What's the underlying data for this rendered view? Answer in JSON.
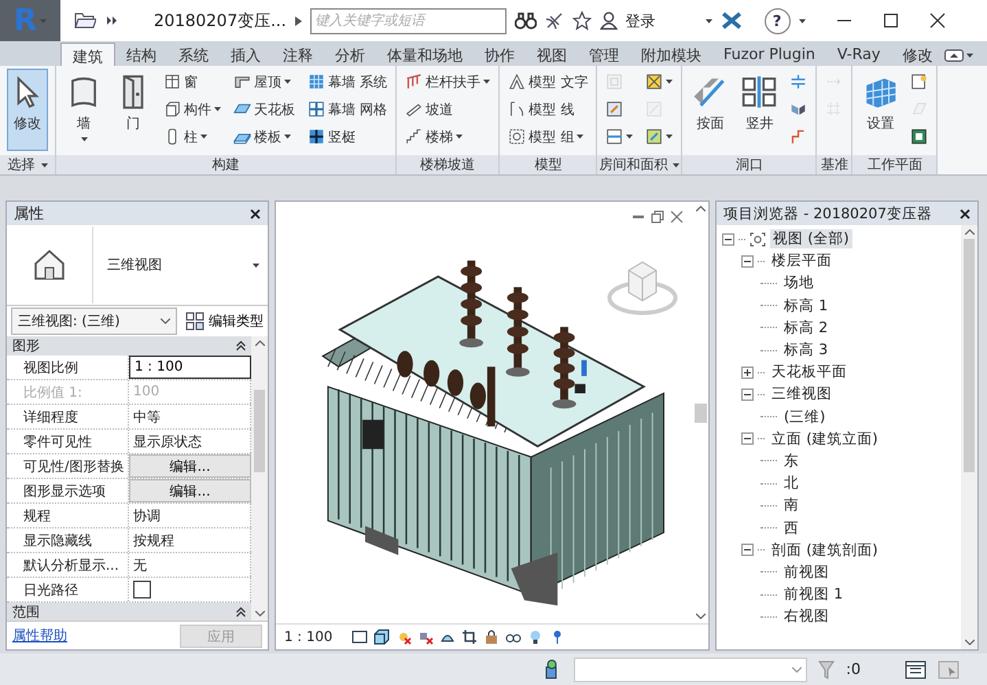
{
  "title_bar": {
    "app_button": "R",
    "title": "20180207变压...",
    "search": {
      "placeholder": "键入关键字或短语"
    },
    "sign_in": "登录",
    "help": "?"
  },
  "tabs": [
    {
      "label": "建筑",
      "selected": true
    },
    {
      "label": "结构",
      "selected": false
    },
    {
      "label": "系统",
      "selected": false
    },
    {
      "label": "插入",
      "selected": false
    },
    {
      "label": "注释",
      "selected": false
    },
    {
      "label": "分析",
      "selected": false
    },
    {
      "label": "体量和场地",
      "selected": false
    },
    {
      "label": "协作",
      "selected": false
    },
    {
      "label": "视图",
      "selected": false
    },
    {
      "label": "管理",
      "selected": false
    },
    {
      "label": "附加模块",
      "selected": false
    },
    {
      "label": "Fuzor Plugin",
      "selected": false
    },
    {
      "label": "V-Ray",
      "selected": false
    },
    {
      "label": "修改",
      "selected": false
    }
  ],
  "ribbon": {
    "panels": [
      {
        "title": "选择",
        "menu": true,
        "tools": [
          {
            "label": "修改",
            "kind": "large",
            "dropdown": false,
            "active": true
          }
        ]
      },
      {
        "title": "构建",
        "menu": false,
        "tools": [
          {
            "label": "墙",
            "kind": "large",
            "dropdown": true
          },
          {
            "label": "门",
            "kind": "large",
            "dropdown": false
          },
          {
            "label": "窗",
            "kind": "small",
            "dropdown": false
          },
          {
            "label": "构件",
            "kind": "small",
            "dropdown": true
          },
          {
            "label": "柱",
            "kind": "small",
            "dropdown": true
          },
          {
            "label": "屋顶",
            "kind": "small",
            "dropdown": true
          },
          {
            "label": "天花板",
            "kind": "small",
            "dropdown": false
          },
          {
            "label": "楼板",
            "kind": "small",
            "dropdown": true
          },
          {
            "label": "幕墙 系统",
            "kind": "small",
            "dropdown": false
          },
          {
            "label": "幕墙 网格",
            "kind": "small",
            "dropdown": false
          },
          {
            "label": "竖梃",
            "kind": "small",
            "dropdown": false
          }
        ]
      },
      {
        "title": "楼梯坡道",
        "menu": false,
        "tools": [
          {
            "label": "栏杆扶手",
            "kind": "small",
            "dropdown": true
          },
          {
            "label": "坡道",
            "kind": "small",
            "dropdown": false
          },
          {
            "label": "楼梯",
            "kind": "small",
            "dropdown": true
          }
        ]
      },
      {
        "title": "模型",
        "menu": false,
        "tools": [
          {
            "label": "模型 文字",
            "kind": "small",
            "dropdown": false
          },
          {
            "label": "模型 线",
            "kind": "small",
            "dropdown": false
          },
          {
            "label": "模型 组",
            "kind": "small",
            "dropdown": true
          }
        ]
      },
      {
        "title": "房间和面积",
        "menu": true,
        "tools": [
          {
            "kind": "small",
            "dropdown": false,
            "disabled": true
          },
          {
            "kind": "small",
            "dropdown": false,
            "disabled": false
          },
          {
            "kind": "small",
            "dropdown": true,
            "disabled": false
          },
          {
            "kind": "small",
            "dropdown": true,
            "disabled": false
          },
          {
            "kind": "small",
            "dropdown": false,
            "disabled": true
          },
          {
            "kind": "small",
            "dropdown": true,
            "disabled": false
          }
        ]
      },
      {
        "title": "洞口",
        "menu": false,
        "tools": [
          {
            "label": "按面",
            "kind": "large",
            "dropdown": false
          },
          {
            "label": "竖井",
            "kind": "large",
            "dropdown": false
          },
          {
            "kind": "small",
            "dropdown": false
          },
          {
            "kind": "small",
            "dropdown": false
          },
          {
            "kind": "small",
            "dropdown": false
          }
        ]
      },
      {
        "title": "基准",
        "menu": false,
        "tools": [
          {
            "kind": "small",
            "dropdown": false,
            "disabled": true
          },
          {
            "kind": "small",
            "dropdown": false,
            "disabled": true
          }
        ]
      },
      {
        "title": "工作平面",
        "menu": false,
        "tools": [
          {
            "label": "设置",
            "kind": "large",
            "dropdown": false,
            "disabled": false
          },
          {
            "kind": "small",
            "dropdown": false,
            "disabled": false
          },
          {
            "kind": "small",
            "dropdown": false,
            "disabled": true
          },
          {
            "kind": "small",
            "dropdown": false,
            "disabled": false
          }
        ]
      }
    ]
  },
  "properties": {
    "title": "属性",
    "type_name": "三维视图",
    "view_selector": "三维视图: (三维)",
    "edit_type": "编辑类型",
    "groups": [
      {
        "title": "图形",
        "expanded": true,
        "rows": [
          {
            "name": "视图比例",
            "kind": "field",
            "value": "1 : 100",
            "disabled": false
          },
          {
            "name": "比例值 1:",
            "kind": "text",
            "value": "100",
            "disabled": true
          },
          {
            "name": "详细程度",
            "kind": "text",
            "value": "中等",
            "disabled": false
          },
          {
            "name": "零件可见性",
            "kind": "text",
            "value": "显示原状态",
            "disabled": false
          },
          {
            "name": "可见性/图形替换",
            "kind": "button",
            "value": "编辑...",
            "disabled": false
          },
          {
            "name": "图形显示选项",
            "kind": "button",
            "value": "编辑...",
            "disabled": false
          },
          {
            "name": "规程",
            "kind": "text",
            "value": "协调",
            "disabled": false
          },
          {
            "name": "显示隐藏线",
            "kind": "text",
            "value": "按规程",
            "disabled": false
          },
          {
            "name": "默认分析显示...",
            "kind": "text",
            "value": "无",
            "disabled": false
          },
          {
            "name": "日光路径",
            "kind": "checkbox",
            "checked": false,
            "disabled": false
          }
        ]
      },
      {
        "title": "范围",
        "expanded": true
      }
    ],
    "help_link": "属性帮助",
    "apply": {
      "label": "应用",
      "disabled": true
    }
  },
  "view": {
    "scale": "1 : 100"
  },
  "browser": {
    "title": "项目浏览器 - 20180207变压器",
    "tree": [
      {
        "label": "视图 (全部)",
        "selected": true,
        "expanded": true,
        "children": [
          {
            "label": "楼层平面",
            "selected": false,
            "expanded": true,
            "children": [
              {
                "label": "场地",
                "selected": false
              },
              {
                "label": "标高 1",
                "selected": false
              },
              {
                "label": "标高 2",
                "selected": false
              },
              {
                "label": "标高 3",
                "selected": false
              }
            ]
          },
          {
            "label": "天花板平面",
            "selected": false,
            "expanded": false
          },
          {
            "label": "三维视图",
            "selected": false,
            "expanded": true,
            "children": [
              {
                "label": "(三维)",
                "selected": false
              }
            ]
          },
          {
            "label": "立面 (建筑立面)",
            "selected": false,
            "expanded": true,
            "children": [
              {
                "label": "东",
                "selected": false
              },
              {
                "label": "北",
                "selected": false
              },
              {
                "label": "南",
                "selected": false
              },
              {
                "label": "西",
                "selected": false
              }
            ]
          },
          {
            "label": "剖面 (建筑剖面)",
            "selected": false,
            "expanded": true,
            "children": [
              {
                "label": "前视图",
                "selected": false
              },
              {
                "label": "前视图 1",
                "selected": false
              },
              {
                "label": "右视图",
                "selected": false
              }
            ]
          }
        ]
      }
    ]
  },
  "status_bar": {
    "filter_count": ":0"
  }
}
